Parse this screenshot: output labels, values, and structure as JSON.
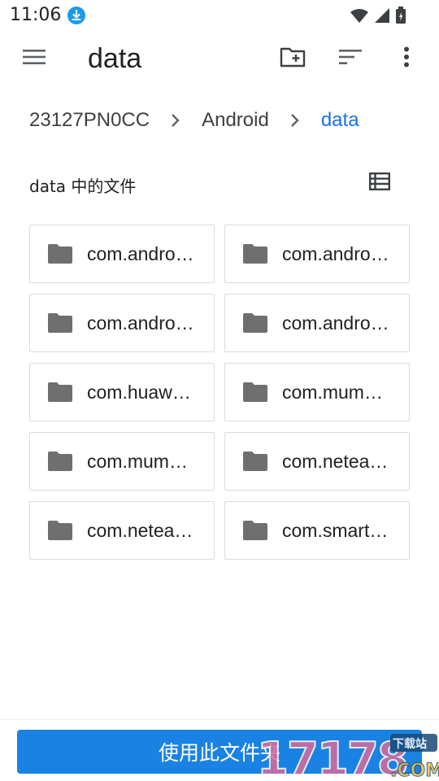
{
  "status_bar": {
    "time": "11:06"
  },
  "app_bar": {
    "title": "data"
  },
  "breadcrumb": {
    "items": [
      "23127PN0CC",
      "Android",
      "data"
    ]
  },
  "section": {
    "title": "data 中的文件"
  },
  "folders": [
    {
      "name": "com.android.backupconfirm",
      "display": "com.andro…"
    },
    {
      "name": "com.android.browser",
      "display": "com.andro…"
    },
    {
      "name": "com.android.externalstorage",
      "display": "com.andro…"
    },
    {
      "name": "com.android.providers.media",
      "display": "com.andro…"
    },
    {
      "name": "com.huawei",
      "display": "com.huaw…"
    },
    {
      "name": "com.mumu.launcher",
      "display": "com.mum…"
    },
    {
      "name": "com.mumu.store",
      "display": "com.mum…"
    },
    {
      "name": "com.netease.cloudmusic",
      "display": "com.netea…"
    },
    {
      "name": "com.netease.mail",
      "display": "com.netea…"
    },
    {
      "name": "com.smartisan",
      "display": "com.smart…"
    }
  ],
  "footer": {
    "button_label": "使用此文件夹"
  },
  "watermark": {
    "text": "17178",
    "badge": "下载站",
    "suffix": ".COM"
  },
  "colors": {
    "accent": "#1a73e8",
    "button": "#1a82e2",
    "icon": "#757575",
    "download_badge": "#1e9be8"
  },
  "icons": [
    "menu-icon",
    "create-folder-icon",
    "sort-icon",
    "more-vert-icon",
    "chevron-right-icon",
    "list-view-icon",
    "folder-icon",
    "download-icon",
    "wifi-icon",
    "signal-icon",
    "battery-icon"
  ]
}
